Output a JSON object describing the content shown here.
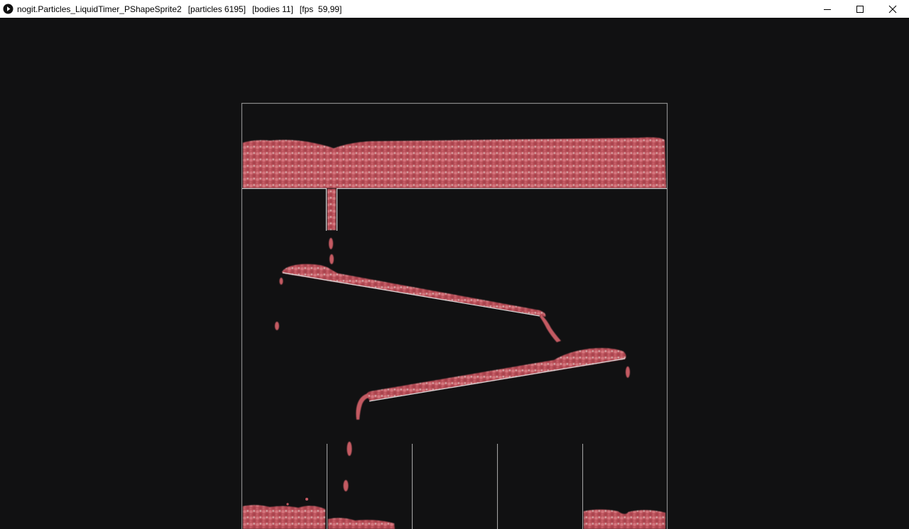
{
  "window": {
    "title": "nogit.Particles_LiquidTimer_PShapeSprite2",
    "particles_label": "[particles 6195]",
    "bodies_label": "[bodies 11]",
    "fps_label": "[fps  59,99]",
    "controls": [
      "minimize-icon",
      "maximize-icon",
      "close-icon"
    ]
  },
  "simulation": {
    "particles": 6195,
    "bodies": 11,
    "fps": "59,99",
    "colors": {
      "background": "#111112",
      "container": "#8a8a8a",
      "liquid": "#c2545c",
      "liquid_highlight": "#d9a4a6"
    }
  }
}
